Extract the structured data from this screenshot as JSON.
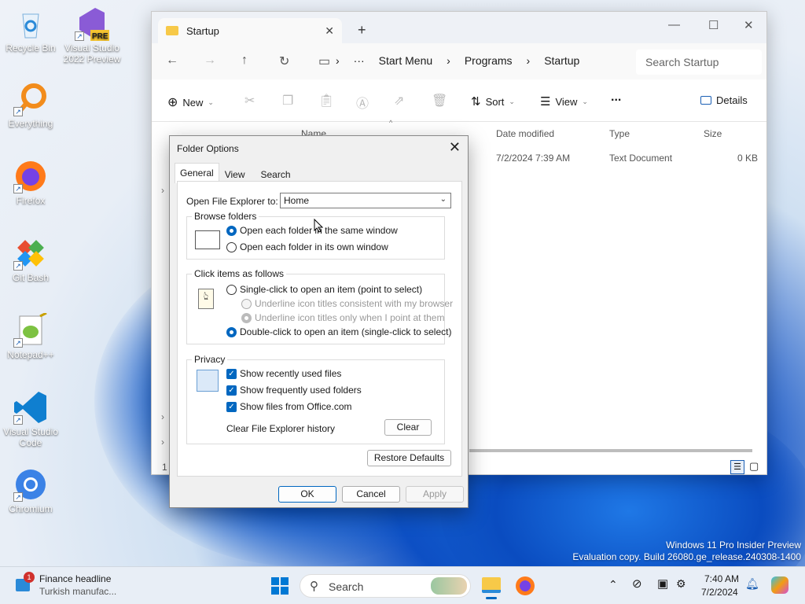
{
  "desktop": {
    "icons": [
      {
        "label": "Recycle Bin"
      },
      {
        "label": "Visual Studio 2022 Preview",
        "badge": "PRE"
      },
      {
        "label": "Everything"
      },
      {
        "label": "Firefox"
      },
      {
        "label": "Git Bash"
      },
      {
        "label": "Notepad++"
      },
      {
        "label": "Visual Studio Code"
      },
      {
        "label": "Chromium"
      }
    ],
    "watermark_line1": "Windows 11 Pro Insider Preview",
    "watermark_line2": "Evaluation copy. Build 26080.ge_release.240308-1400"
  },
  "explorer": {
    "tab_title": "Startup",
    "breadcrumbs": [
      "Start Menu",
      "Programs",
      "Startup"
    ],
    "search_placeholder": "Search Startup",
    "toolbar": {
      "new": "New",
      "sort": "Sort",
      "view": "View",
      "more": "...",
      "details": "Details"
    },
    "columns": {
      "name": "Name",
      "date": "Date modified",
      "type": "Type",
      "size": "Size"
    },
    "rows": [
      {
        "date": "7/2/2024 7:39 AM",
        "type": "Text Document",
        "size": "0 KB"
      }
    ],
    "status_count": "1"
  },
  "dialog": {
    "title": "Folder Options",
    "tabs": [
      "General",
      "View",
      "Search"
    ],
    "open_label": "Open File Explorer to:",
    "open_value": "Home",
    "browse_group": "Browse folders",
    "browse_same": "Open each folder in the same window",
    "browse_own": "Open each folder in its own window",
    "click_group": "Click items as follows",
    "single_click": "Single-click to open an item (point to select)",
    "underline_browser": "Underline icon titles consistent with my browser",
    "underline_point": "Underline icon titles only when I point at them",
    "double_click": "Double-click to open an item (single-click to select)",
    "privacy_group": "Privacy",
    "recent_files": "Show recently used files",
    "frequent_folders": "Show frequently used folders",
    "office_files": "Show files from Office.com",
    "clear_history": "Clear File Explorer history",
    "clear_btn": "Clear",
    "restore_btn": "Restore Defaults",
    "ok": "OK",
    "cancel": "Cancel",
    "apply": "Apply"
  },
  "taskbar": {
    "news_title": "Finance headline",
    "news_sub": "Turkish manufac...",
    "news_badge": "1",
    "search_label": "Search",
    "time": "7:40 AM",
    "date": "7/2/2024"
  }
}
